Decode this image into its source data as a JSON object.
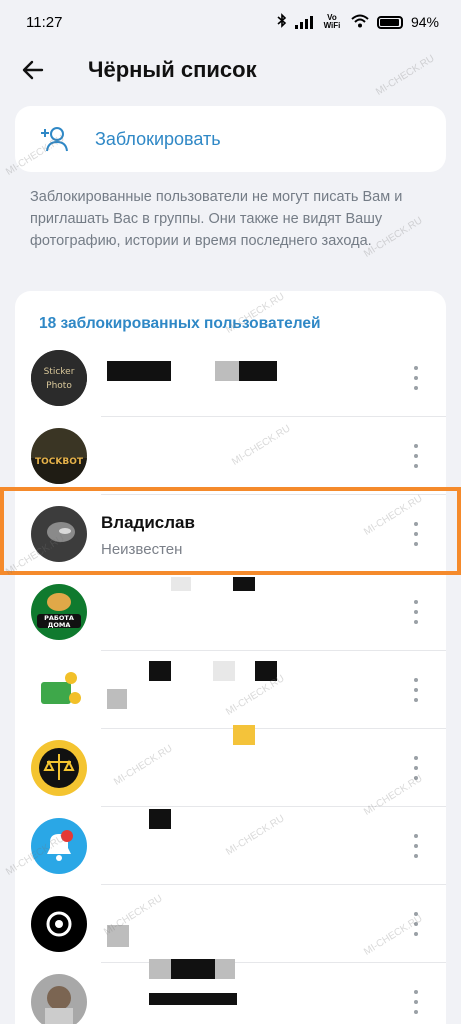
{
  "status_bar": {
    "time": "11:27",
    "network_label": "Vo WiFi",
    "battery": "94%"
  },
  "header": {
    "title": "Чёрный список"
  },
  "block_action": {
    "label": "Заблокировать"
  },
  "info_text": "Заблокированные пользователи не могут писать Вам и приглашать Вас в группы. Они также не видят Вашу фотографию, истории и время последнего захода.",
  "blocked_list": {
    "header": "18 заблокированных пользователей",
    "items": [
      {
        "name": "",
        "status": "",
        "avatar_text": "Sticker Photo",
        "avatar_color": "#2b2b2b"
      },
      {
        "name": "",
        "status": "",
        "avatar_text": "TOCKBOT",
        "avatar_color": "#3a3524"
      },
      {
        "name": "Владислав",
        "status": "Неизвестен",
        "avatar_text": "",
        "avatar_color": "#3c3c3c"
      },
      {
        "name": "",
        "status": "",
        "avatar_text": "РАБОТА ДОМА",
        "avatar_color": "#0f7a2e"
      },
      {
        "name": "",
        "status": "",
        "avatar_text": "",
        "avatar_color": "#ffffff"
      },
      {
        "name": "",
        "status": "",
        "avatar_text": "",
        "avatar_color": "#f4c430"
      },
      {
        "name": "",
        "status": "",
        "avatar_text": "",
        "avatar_color": "#2aa7e6"
      },
      {
        "name": "",
        "status": "",
        "avatar_text": "",
        "avatar_color": "#000000"
      },
      {
        "name": "",
        "status": "",
        "avatar_text": "",
        "avatar_color": "#a8a8a8"
      }
    ]
  },
  "watermark": "MI-CHECK.RU",
  "colors": {
    "accent": "#2f88c6",
    "highlight": "#f58a2b",
    "background": "#f1f2f6"
  }
}
